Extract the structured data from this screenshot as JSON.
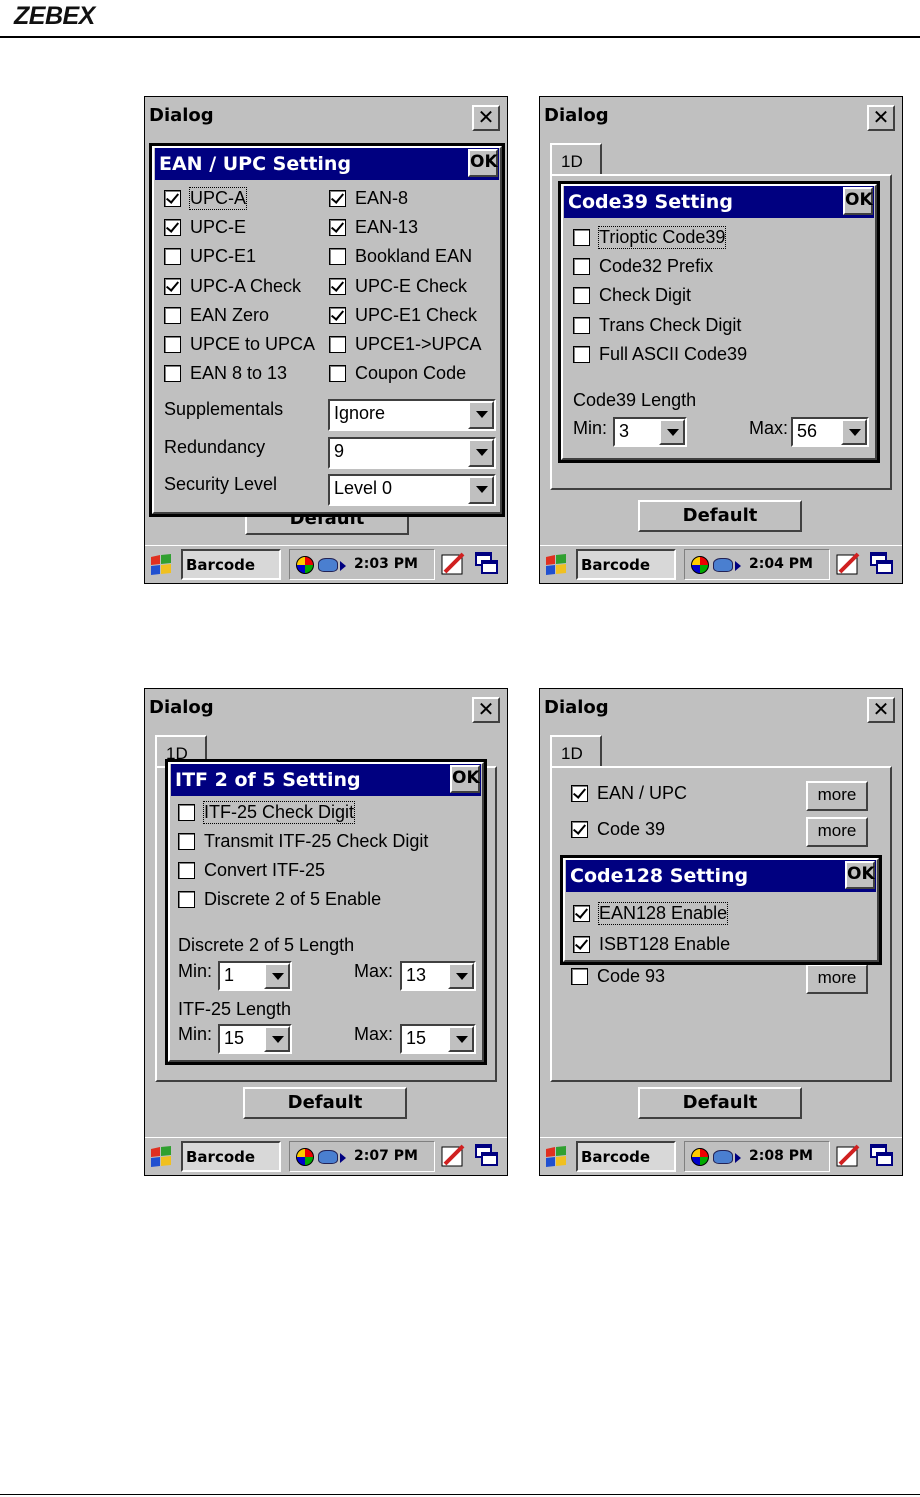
{
  "brand": "ZEBEX",
  "screens": [
    {
      "title": "Dialog",
      "close": "✕",
      "popup_title": "EAN / UPC Setting",
      "ok": "OK",
      "checkboxes": [
        {
          "label": "UPC-A",
          "checked": true
        },
        {
          "label": "EAN-8",
          "checked": true
        },
        {
          "label": "UPC-E",
          "checked": true
        },
        {
          "label": "EAN-13",
          "checked": true
        },
        {
          "label": "UPC-E1",
          "checked": false
        },
        {
          "label": "Bookland EAN",
          "checked": false
        },
        {
          "label": "UPC-A Check",
          "checked": true
        },
        {
          "label": "UPC-E Check",
          "checked": true
        },
        {
          "label": "EAN Zero",
          "checked": false
        },
        {
          "label": "UPC-E1 Check",
          "checked": true
        },
        {
          "label": "UPCE to UPCA",
          "checked": false
        },
        {
          "label": "UPCE1->UPCA",
          "checked": false
        },
        {
          "label": "EAN 8 to 13",
          "checked": false
        },
        {
          "label": "Coupon Code",
          "checked": false
        }
      ],
      "fields": [
        {
          "label": "Supplementals",
          "value": "Ignore"
        },
        {
          "label": "Redundancy",
          "value": "9"
        },
        {
          "label": "Security Level",
          "value": "Level 0"
        }
      ],
      "default_button": "Default",
      "taskbar": {
        "app": "Barcode",
        "time": "2:03 PM"
      }
    },
    {
      "title": "Dialog",
      "close": "✕",
      "tab": "1D",
      "popup_title": "Code39 Setting",
      "ok": "OK",
      "checkboxes": [
        {
          "label": "Trioptic Code39",
          "checked": false
        },
        {
          "label": "Code32 Prefix",
          "checked": false
        },
        {
          "label": "Check Digit",
          "checked": false
        },
        {
          "label": "Trans Check Digit",
          "checked": false
        },
        {
          "label": "Full ASCII Code39",
          "checked": false
        }
      ],
      "length_label": "Code39 Length",
      "min_label": "Min:",
      "min_value": "3",
      "max_label": "Max:",
      "max_value": "56",
      "default_button": "Default",
      "taskbar": {
        "app": "Barcode",
        "time": "2:04 PM"
      }
    },
    {
      "title": "Dialog",
      "close": "✕",
      "tab": "1D",
      "popup_title": "ITF 2 of 5 Setting",
      "ok": "OK",
      "checkboxes": [
        {
          "label": "ITF-25 Check Digit",
          "checked": false
        },
        {
          "label": "Transmit ITF-25 Check Digit",
          "checked": false
        },
        {
          "label": "Convert ITF-25",
          "checked": false
        },
        {
          "label": "Discrete 2 of 5 Enable",
          "checked": false
        }
      ],
      "discrete_label": "Discrete 2 of 5 Length",
      "itf_label": "ITF-25 Length",
      "min_label": "Min:",
      "max_label": "Max:",
      "discrete_min": "1",
      "discrete_max": "13",
      "itf_min": "15",
      "itf_max": "15",
      "default_button": "Default",
      "taskbar": {
        "app": "Barcode",
        "time": "2:07 PM"
      }
    },
    {
      "title": "Dialog",
      "close": "✕",
      "tab": "1D",
      "list": [
        {
          "label": "EAN / UPC",
          "checked": true,
          "more": "more"
        },
        {
          "label": "Code 39",
          "checked": true,
          "more": "more"
        },
        {
          "label": "Code 93",
          "checked": false,
          "more": "more"
        }
      ],
      "popup_title": "Code128 Setting",
      "ok": "OK",
      "checkboxes": [
        {
          "label": "EAN128 Enable",
          "checked": true
        },
        {
          "label": "ISBT128 Enable",
          "checked": true
        }
      ],
      "default_button": "Default",
      "taskbar": {
        "app": "Barcode",
        "time": "2:08 PM"
      }
    }
  ]
}
